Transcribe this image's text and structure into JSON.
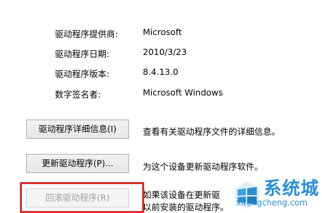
{
  "driver_info": {
    "provider_label": "驱动程序提供商:",
    "provider_value": "Microsoft",
    "date_label": "驱动程序日期:",
    "date_value": "2010/3/23",
    "version_label": "驱动程序版本:",
    "version_value": "8.4.13.0",
    "signer_label": "数字签名者:",
    "signer_value": "Microsoft Windows"
  },
  "buttons": {
    "details_label": "驱动程序详细信息(I)",
    "details_desc": "查看有关驱动程序文件的详细信息。",
    "update_label": "更新驱动程序(P)...",
    "update_desc": "为这个设备更新驱动程序软件。",
    "rollback_label": "回滚驱动程序(R)",
    "rollback_desc_line1": "如果该设备在更新驱",
    "rollback_desc_line2": "以前安装的驱动程序。"
  },
  "watermark": {
    "cn_text": "系统城",
    "en_text": "xitongcheng.com",
    "color": "#2b8fd6"
  },
  "highlight_color": "#e0302b"
}
